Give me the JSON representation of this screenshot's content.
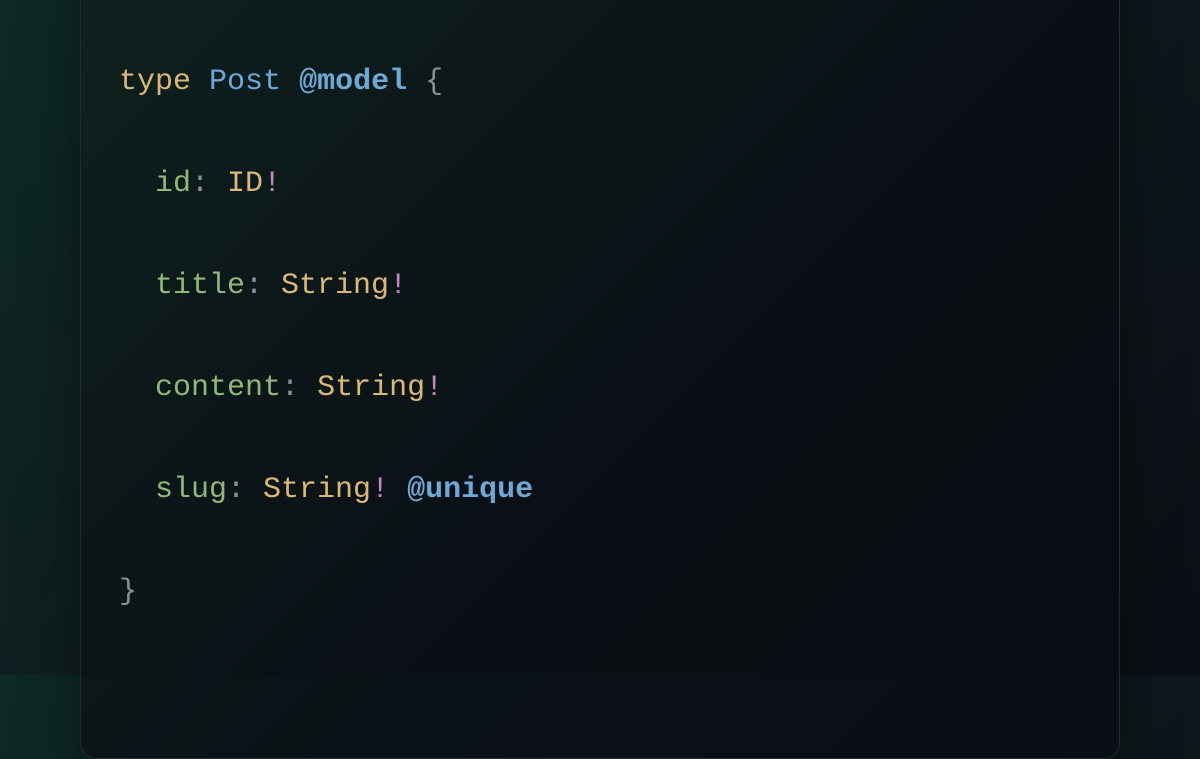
{
  "code": {
    "line1": {
      "keyword": "type",
      "typeName": "Post",
      "directive": "@model",
      "openBrace": "{"
    },
    "line2": {
      "field": "id",
      "colon": ":",
      "type": "ID",
      "bang": "!"
    },
    "line3": {
      "field": "title",
      "colon": ":",
      "type": "String",
      "bang": "!"
    },
    "line4": {
      "field": "content",
      "colon": ":",
      "type": "String",
      "bang": "!"
    },
    "line5": {
      "field": "slug",
      "colon": ":",
      "type": "String",
      "bang": "!",
      "directive": "@unique"
    },
    "line6": {
      "closeBrace": "}"
    }
  }
}
